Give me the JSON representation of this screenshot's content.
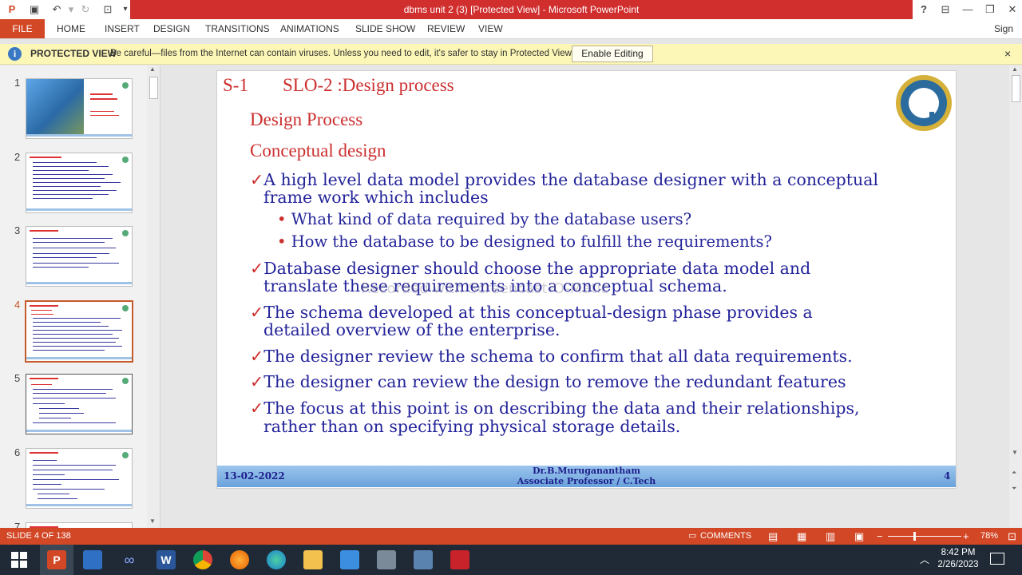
{
  "window": {
    "title": "dbms unit 2 (3) [Protected View] - Microsoft PowerPoint",
    "help": "?",
    "controls": [
      "restore-ribbon",
      "minimize",
      "maximize",
      "close"
    ]
  },
  "ribbon": {
    "file_label": "FILE",
    "tabs": [
      "HOME",
      "INSERT",
      "DESIGN",
      "TRANSITIONS",
      "ANIMATIONS",
      "SLIDE SHOW",
      "REVIEW",
      "VIEW"
    ],
    "sign_in": "Sign in"
  },
  "protected_view": {
    "label": "PROTECTED VIEW",
    "message": "Be careful—files from the Internet can contain viruses. Unless you need to edit, it's safer to stay in Protected View.",
    "button": "Enable Editing",
    "close": "×"
  },
  "thumbnails": {
    "numbers": [
      "1",
      "2",
      "3",
      "4",
      "5",
      "6",
      "7"
    ],
    "selected_index": 3
  },
  "slide": {
    "header_id": "S-1",
    "header_title": "SLO-2 :Design process",
    "heading1": "Design Process",
    "heading2": "Conceptual design",
    "bullets": [
      {
        "line1": "A high level data model provides the database designer with a conceptual",
        "line2": "frame work which includes"
      },
      {
        "line1": "Database designer should choose the appropriate data model  and",
        "line2": "translate these requirements into a conceptual schema."
      },
      {
        "line1": "The schema developed at this conceptual-design phase provides a",
        "line2": "detailed overview of the enterprise."
      },
      {
        "line1": "The designer review the schema to confirm that all data requirements.",
        "line2": ""
      },
      {
        "line1": "The designer can review the design to remove the redundant features",
        "line2": ""
      },
      {
        "line1": "The focus at this point is on describing the data and their relationships,",
        "line2": "rather than on specifying physical storage details."
      }
    ],
    "sub_bullets": [
      "What kind of data required by the database users?",
      "How the database to be designed to fulfill the requirements?"
    ],
    "check_mark": "✓",
    "sub_mark": "•",
    "watermark": "Recorded with Screencast-O-Matic",
    "footer": {
      "date": "13-02-2022",
      "author": "Dr.B.Muruganantham",
      "role": "Associate Professor / C.Tech",
      "page": "4"
    }
  },
  "status": {
    "slide_info": "SLIDE 4 OF 138",
    "comments": "COMMENTS",
    "zoom": "78%"
  },
  "taskbar": {
    "time": "8:42 PM",
    "date": "2/26/2023"
  },
  "colors": {
    "accent": "#d24726",
    "title_red": "#d12e2e",
    "slide_blue": "#23239a",
    "slide_red": "#cc2f2f",
    "protected_bg": "#fcf7b6"
  }
}
